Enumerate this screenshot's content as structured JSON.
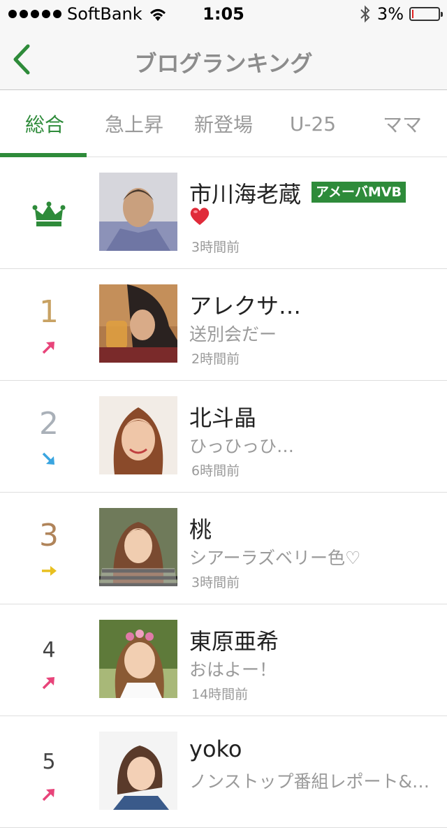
{
  "status_bar": {
    "carrier": "SoftBank",
    "time": "1:05",
    "battery": "3%",
    "battery_level": 0.03,
    "icons": [
      "signal-dots-icon",
      "wifi-icon",
      "bluetooth-icon",
      "battery-icon"
    ]
  },
  "nav": {
    "title": "ブログランキング",
    "back_icon": "chevron-left-icon"
  },
  "tabs": [
    {
      "label": "総合",
      "active": true
    },
    {
      "label": "急上昇",
      "active": false
    },
    {
      "label": "新登場",
      "active": false
    },
    {
      "label": "U-25",
      "active": false
    },
    {
      "label": "ママ",
      "active": false
    }
  ],
  "rankings": [
    {
      "rank": "",
      "trend": "crown",
      "name": "市川海老蔵",
      "badge": "アメーバMVB",
      "desc": "",
      "heart": true,
      "time": "3時間前"
    },
    {
      "rank": "1",
      "trend": "up",
      "name": "アレクサ…",
      "badge": "",
      "desc": "送別会だー",
      "heart": false,
      "time": "2時間前"
    },
    {
      "rank": "2",
      "trend": "down",
      "name": "北斗晶",
      "badge": "",
      "desc": "ひっひっひ…",
      "heart": false,
      "time": "6時間前"
    },
    {
      "rank": "3",
      "trend": "same",
      "name": "桃",
      "badge": "",
      "desc": "シアーラズベリー色♡",
      "heart": false,
      "time": "3時間前"
    },
    {
      "rank": "4",
      "trend": "up",
      "name": "東原亜希",
      "badge": "",
      "desc": "おはよー！",
      "heart": false,
      "time": "14時間前"
    },
    {
      "rank": "5",
      "trend": "up",
      "name": "yoko",
      "badge": "",
      "desc": "ノンストップ番組レポート&…",
      "heart": false,
      "time": ""
    }
  ],
  "colors": {
    "accent": "#2e8b3a",
    "gold": "#c8a263",
    "silver": "#a9b0b8",
    "bronze": "#b0845a",
    "trend_up": "#e8447a",
    "trend_down": "#3aa5e0",
    "trend_same": "#e8c020"
  }
}
